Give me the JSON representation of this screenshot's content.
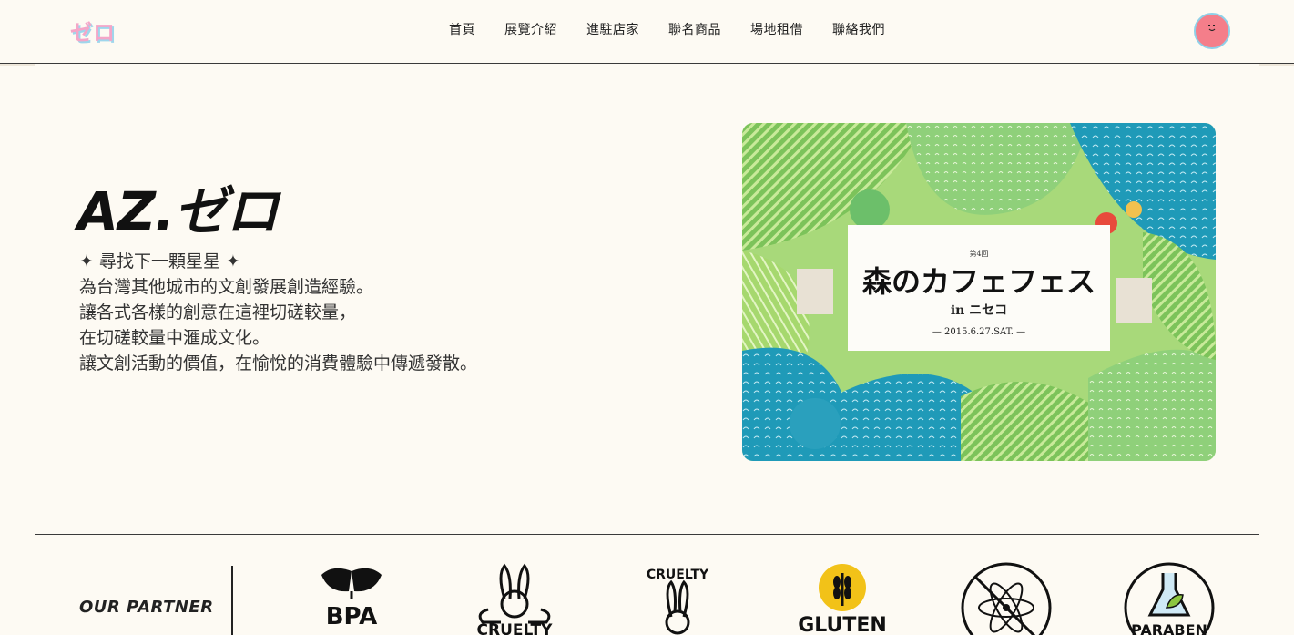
{
  "header": {
    "logo_text": "ゼロ",
    "nav": [
      "首頁",
      "展覽介紹",
      "進駐店家",
      "聯名商品",
      "場地租借",
      "聯絡我們"
    ]
  },
  "hero": {
    "title": "AZ.ゼロ",
    "lines": [
      "✦ 尋找下一顆星星 ✦",
      "為台灣其他城市的文創發展創造經驗。",
      "讓各式各樣的創意在這裡切磋較量，",
      "在切磋較量中滙成文化。",
      "讓文創活動的價值，在愉悅的消費體驗中傳遞發散。"
    ],
    "image": {
      "label_small": "第4回",
      "title_jp": "森のカフェフェス",
      "subtitle_jp": "in ニセコ",
      "date": "— 2015.6.27.SAT. —"
    }
  },
  "partners": {
    "title": "OUR PARTNER",
    "logos": [
      {
        "name": "bpa-free-logo",
        "text": "BPA"
      },
      {
        "name": "cruelty-free-bunny-logo",
        "text": "CRUELTY"
      },
      {
        "name": "cruelty-free-stamp-logo",
        "text": "CRUELTY"
      },
      {
        "name": "gluten-free-logo",
        "text": "GLUTEN"
      },
      {
        "name": "no-chemicals-logo",
        "text": ""
      },
      {
        "name": "paraben-free-logo",
        "text": "PARABEN"
      }
    ]
  },
  "colors": {
    "background": "#fdfaf3",
    "logo_pink": "#f4a6c8",
    "logo_blue": "#9fd6ec",
    "avatar_red": "#f47e8a"
  }
}
